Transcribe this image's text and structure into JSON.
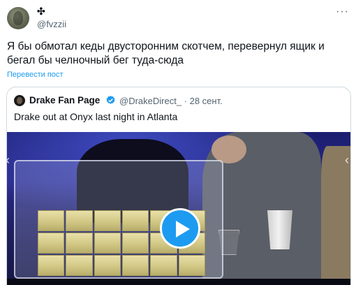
{
  "tweet": {
    "name_glyph": "✣",
    "handle": "@fvzzii",
    "more_label": "···",
    "text": "Я бы обмотал кеды двусторонним скотчем, перевернул ящик и бегал бы челночный бег туда-сюда",
    "translate_label": "Перевести пост"
  },
  "quote": {
    "name": "Drake Fan Page",
    "handle_time": "@DrakeDirect_ · 28 сент.",
    "text": "Drake out at Onyx last night in Atlanta",
    "verified_color": "#1d9bf0"
  },
  "media": {
    "nav_left": "‹",
    "nav_right": "‹",
    "play_icon": "play-icon"
  }
}
